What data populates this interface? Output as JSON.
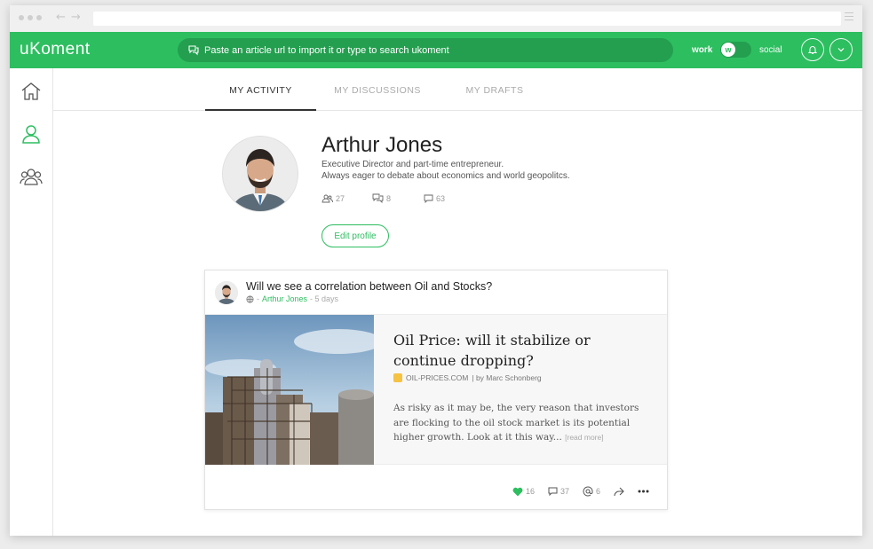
{
  "app": {
    "logo": "uKoment"
  },
  "search": {
    "placeholder": "Paste an article url to import it or type to search ukoment"
  },
  "mode": {
    "left": "work",
    "knob": "w",
    "right": "social"
  },
  "sidebar": {
    "items": [
      "home-icon",
      "user-icon",
      "group-icon"
    ],
    "active": "user-icon"
  },
  "tabs": [
    {
      "label": "MY ACTIVITY",
      "active": true
    },
    {
      "label": "MY DISCUSSIONS",
      "active": false
    },
    {
      "label": "MY DRAFTS",
      "active": false
    }
  ],
  "profile": {
    "name": "Arthur Jones",
    "bio_line1": "Executive Director and part-time entrepreneur.",
    "bio_line2": "Always eager to debate about economics and world geopolitcs.",
    "stats": {
      "followers": "27",
      "discussions": "8",
      "comments": "63"
    },
    "edit_label": "Edit profile"
  },
  "post": {
    "title": "Will we see a correlation between Oil and Stocks?",
    "meta_prefix": "-",
    "author": "Arthur Jones",
    "age": "- 5 days",
    "article": {
      "title": "Oil Price: will it stabilize or continue dropping?",
      "source": "OIL-PRICES.COM",
      "byline": "| by Marc Schonberg",
      "excerpt": "As risky as it may be, the very reason that investors are flocking to the oil stock market is its potential higher growth. Look at it this way...",
      "read_more": "[read more]"
    },
    "actions": {
      "likes": "16",
      "comments": "37",
      "mentions": "6"
    }
  },
  "colors": {
    "brand": "#2dbe60",
    "brand_dark": "#239f4f",
    "source_icon": "#f5c242"
  }
}
